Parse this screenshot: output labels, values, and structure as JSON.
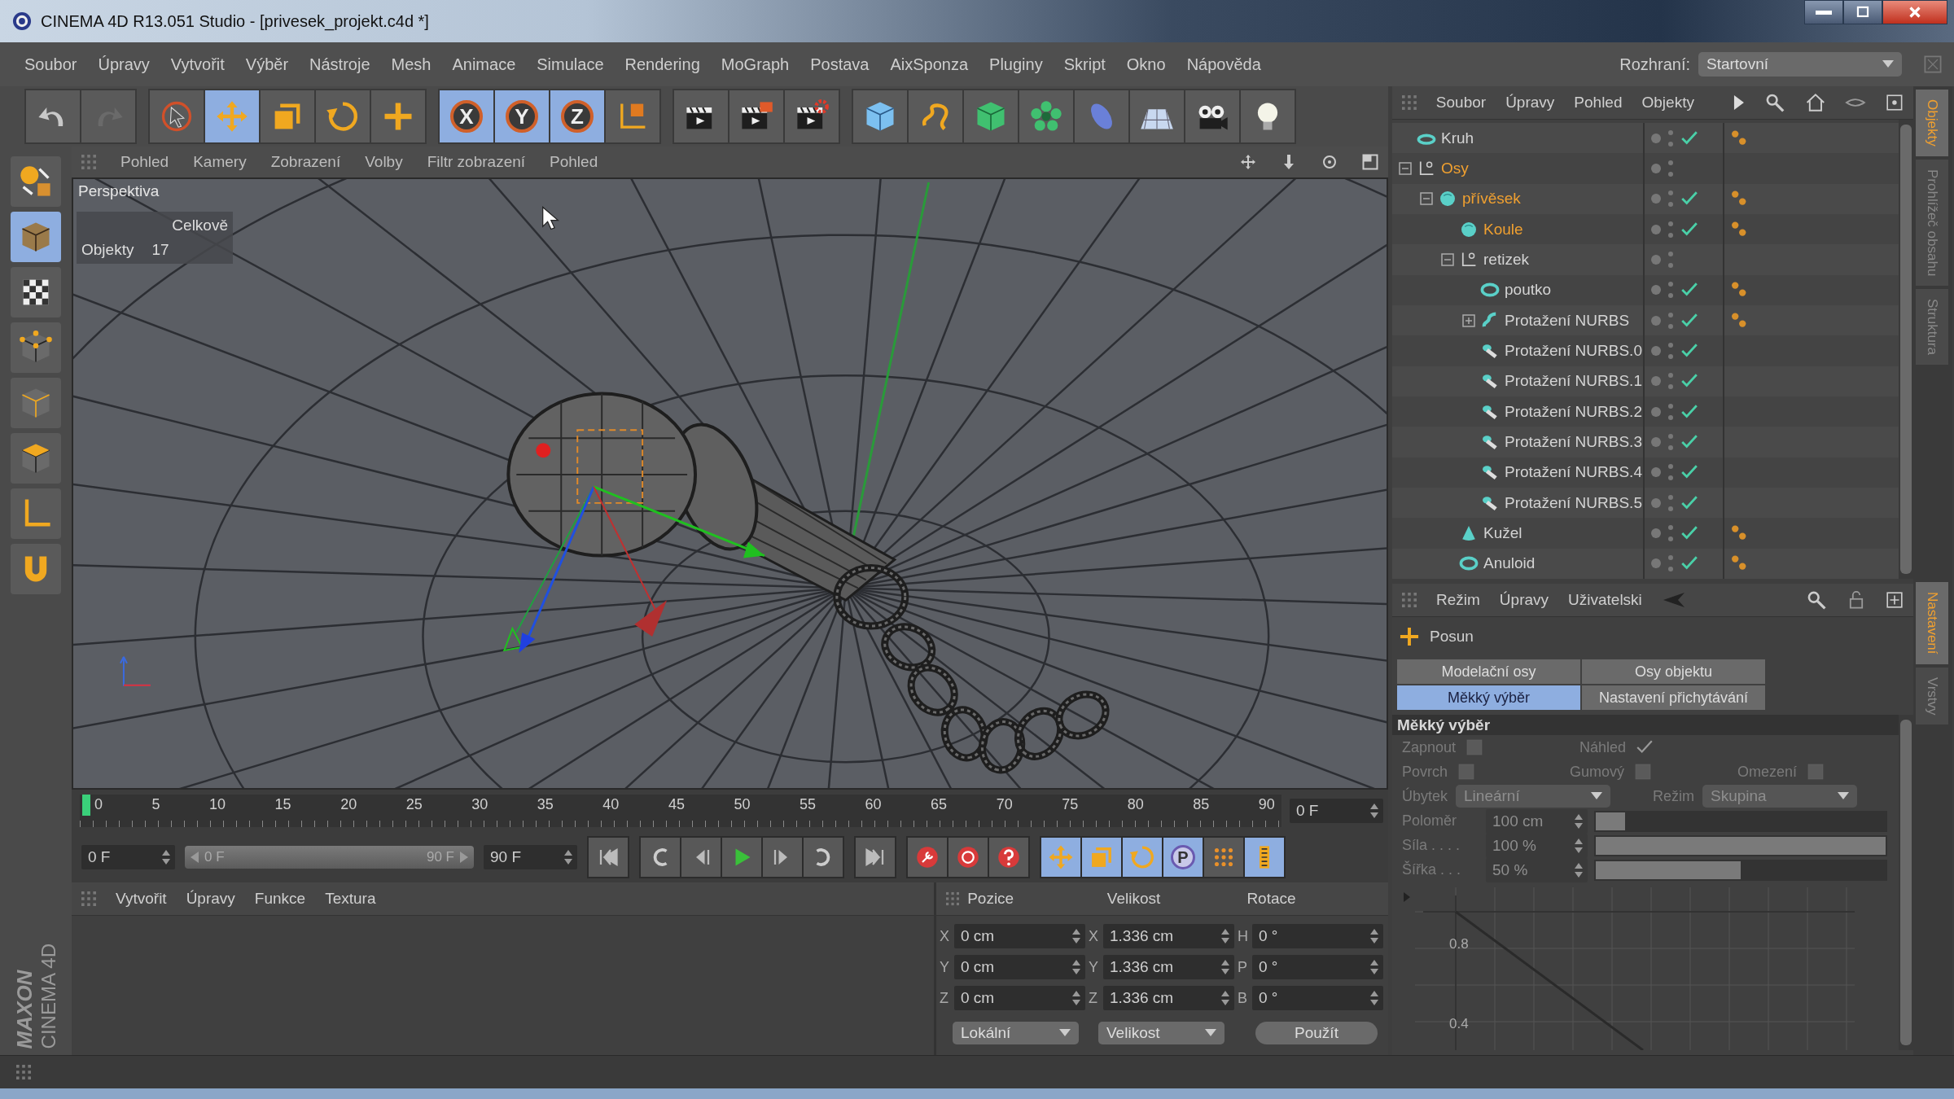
{
  "window": {
    "title": "CINEMA 4D R13.051 Studio - [privesek_projekt.c4d *]"
  },
  "menu_bar": {
    "items": [
      "Soubor",
      "Úpravy",
      "Vytvořit",
      "Výběr",
      "Nástroje",
      "Mesh",
      "Animace",
      "Simulace",
      "Rendering",
      "MoGraph",
      "Postava",
      "AixSponza",
      "Pluginy",
      "Skript",
      "Okno",
      "Nápověda"
    ],
    "layout_label": "Rozhraní:",
    "layout_value": "Startovní"
  },
  "toolbar": [
    {
      "items": [
        {
          "kind": "undo",
          "disabled": false
        },
        {
          "kind": "redo",
          "disabled": true
        }
      ]
    },
    {
      "items": [
        {
          "kind": "live-select",
          "selected": false
        },
        {
          "kind": "move",
          "selected": true
        },
        {
          "kind": "scale",
          "selected": false
        },
        {
          "kind": "rotate",
          "selected": false
        },
        {
          "kind": "add",
          "selected": false
        }
      ]
    },
    {
      "items": [
        {
          "kind": "axis",
          "label": "X",
          "selected": true
        },
        {
          "kind": "axis",
          "label": "Y",
          "selected": true
        },
        {
          "kind": "axis",
          "label": "Z",
          "selected": true
        },
        {
          "kind": "coordinate-system",
          "selected": false
        }
      ]
    },
    {
      "items": [
        {
          "kind": "render-view",
          "selected": false
        },
        {
          "kind": "render-picture",
          "selected": false
        },
        {
          "kind": "render-settings",
          "selected": false
        }
      ]
    },
    {
      "items": [
        {
          "kind": "cube",
          "selected": false
        },
        {
          "kind": "spline",
          "selected": false
        },
        {
          "kind": "nurbs",
          "selected": false
        },
        {
          "kind": "array",
          "selected": false
        },
        {
          "kind": "deformer",
          "selected": false
        },
        {
          "kind": "floor",
          "selected": false
        },
        {
          "kind": "camera",
          "selected": false
        },
        {
          "kind": "light",
          "selected": false
        }
      ]
    }
  ],
  "left_toolbar": [
    {
      "kind": "workplane",
      "selected": false
    },
    {
      "kind": "model",
      "selected": true
    },
    {
      "kind": "texture",
      "selected": false
    },
    {
      "kind": "points",
      "selected": false
    },
    {
      "kind": "edges",
      "selected": false
    },
    {
      "kind": "polygons",
      "selected": false
    },
    {
      "kind": "axis-mode",
      "selected": false
    },
    {
      "kind": "snap",
      "selected": false
    }
  ],
  "logo": {
    "line_1": "MAXON",
    "line_2": "CINEMA 4D"
  },
  "viewport": {
    "menu": [
      "Pohled",
      "Kamery",
      "Zobrazení",
      "Volby",
      "Filtr zobrazení",
      "Pohled"
    ],
    "camera": "Perspektiva",
    "stats_header": "Celkově",
    "stats": [
      {
        "label": "Objekty",
        "value": "17"
      }
    ]
  },
  "timeline": {
    "ticks": [
      "0",
      "5",
      "10",
      "15",
      "20",
      "25",
      "30",
      "35",
      "40",
      "45",
      "50",
      "55",
      "60",
      "65",
      "70",
      "75",
      "80",
      "85",
      "90"
    ],
    "level": 0,
    "frame": "0 F",
    "start": "0 F",
    "range": {
      "start": "0 F",
      "end": "90 F",
      "level": 1
    },
    "end": "90 F",
    "tools": [
      {
        "kind": "move",
        "selected": true
      },
      {
        "kind": "scale",
        "selected": true
      },
      {
        "kind": "rotate",
        "selected": true
      },
      {
        "kind": "parameter",
        "label": "P",
        "selected": true
      },
      {
        "kind": "point-level",
        "selected": false
      },
      {
        "kind": "timeline",
        "selected": true
      }
    ]
  },
  "material_manager": {
    "menu": [
      "Vytvořit",
      "Úpravy",
      "Funkce",
      "Textura"
    ]
  },
  "coordinates": {
    "headers": [
      "Pozice",
      "Velikost",
      "Rotace"
    ],
    "rows": [
      {
        "labels": [
          "X",
          "X",
          "H"
        ],
        "values": [
          "0 cm",
          "1.336 cm",
          "0 °"
        ]
      },
      {
        "labels": [
          "Y",
          "Y",
          "P"
        ],
        "values": [
          "0 cm",
          "1.336 cm",
          "0 °"
        ]
      },
      {
        "labels": [
          "Z",
          "Z",
          "B"
        ],
        "values": [
          "0 cm",
          "1.336 cm",
          "0 °"
        ]
      }
    ],
    "dropdowns": [
      "Lokální",
      "Velikost"
    ],
    "apply": "Použít"
  },
  "object_manager": {
    "menu": [
      "Soubor",
      "Úpravy",
      "Pohled",
      "Objekty"
    ],
    "tree": [
      {
        "name": "Kruh",
        "kind": "circle",
        "selected": false,
        "enabled": true,
        "tags": true
      },
      {
        "name": "Osy",
        "kind": "null",
        "selected": true,
        "enabled": false,
        "tags": false,
        "expanded": true,
        "children": [
          {
            "name": "přívěsek",
            "kind": "sphere",
            "selected": true,
            "enabled": true,
            "tags": true,
            "expanded": true,
            "children": [
              {
                "name": "Koule",
                "kind": "sphere",
                "selected": true,
                "enabled": true,
                "tags": true
              },
              {
                "name": "retizek",
                "kind": "null",
                "selected": false,
                "enabled": false,
                "tags": false,
                "expanded": true,
                "children": [
                  {
                    "name": "poutko",
                    "kind": "torus",
                    "selected": false,
                    "enabled": true,
                    "tags": true
                  },
                  {
                    "name": "Protažení NURBS",
                    "kind": "sweep",
                    "selected": false,
                    "enabled": true,
                    "tags": true,
                    "expanded": false
                  },
                  {
                    "name": "Protažení NURBS.0",
                    "kind": "sweep-copy",
                    "selected": false,
                    "enabled": true,
                    "tags": false
                  },
                  {
                    "name": "Protažení NURBS.1",
                    "kind": "sweep-copy",
                    "selected": false,
                    "enabled": true,
                    "tags": false
                  },
                  {
                    "name": "Protažení NURBS.2",
                    "kind": "sweep-copy",
                    "selected": false,
                    "enabled": true,
                    "tags": false
                  },
                  {
                    "name": "Protažení NURBS.3",
                    "kind": "sweep-copy",
                    "selected": false,
                    "enabled": true,
                    "tags": false
                  },
                  {
                    "name": "Protažení NURBS.4",
                    "kind": "sweep-copy",
                    "selected": false,
                    "enabled": true,
                    "tags": false
                  },
                  {
                    "name": "Protažení NURBS.5",
                    "kind": "sweep-copy",
                    "selected": false,
                    "enabled": true,
                    "tags": false
                  }
                ]
              },
              {
                "name": "Kužel",
                "kind": "cone",
                "selected": false,
                "enabled": true,
                "tags": true
              },
              {
                "name": "Anuloid",
                "kind": "torus",
                "selected": false,
                "enabled": true,
                "tags": true
              }
            ]
          }
        ]
      }
    ]
  },
  "side_tabs_top": [
    {
      "label": "Objekty",
      "selected": true
    },
    {
      "label": "Prohlížeč obsahu",
      "selected": false
    },
    {
      "label": "Struktura",
      "selected": false
    }
  ],
  "attributes": {
    "menu": [
      "Režim",
      "Úpravy",
      "Uživatelski"
    ],
    "tool": "Posun",
    "tabs": [
      {
        "label": "Modelační osy",
        "selected": false
      },
      {
        "label": "Osy objektu",
        "selected": false
      },
      {
        "label": "Měkký výběr",
        "selected": true
      },
      {
        "label": "Nastavení přichytávání",
        "selected": false
      }
    ],
    "section": "Měkký výběr",
    "param_rows": [
      [
        {
          "kind": "checkbox",
          "label": "Zapnout",
          "checked": false,
          "disabled": true
        },
        {
          "kind": "checkbox",
          "label": "Náhled",
          "checked": true,
          "disabled": true
        }
      ],
      [
        {
          "kind": "checkbox",
          "label": "Povrch",
          "checked": false,
          "disabled": true
        },
        {
          "kind": "checkbox",
          "label": "Gumový",
          "checked": false,
          "disabled": true
        },
        {
          "kind": "checkbox",
          "label": "Omezení",
          "checked": false,
          "disabled": true
        }
      ],
      [
        {
          "kind": "dropdown",
          "label": "Úbytek",
          "value": "Lineární",
          "disabled": true
        },
        {
          "kind": "dropdown",
          "label": "Režim",
          "value": "Skupina",
          "disabled": true
        }
      ],
      [
        {
          "kind": "slider",
          "label": "Poloměr",
          "value": "100 cm",
          "level": 0.1,
          "disabled": true
        }
      ],
      [
        {
          "kind": "slider",
          "label": "Síla . . . .",
          "value": "100 %",
          "level": 1,
          "disabled": true
        }
      ],
      [
        {
          "kind": "slider",
          "label": "Šířka . . .",
          "value": "50 %",
          "level": 0.5,
          "disabled": true
        }
      ]
    ],
    "falloff": {
      "tick_labels": [
        "0.8",
        "0.4"
      ]
    }
  },
  "side_tabs_bottom": [
    {
      "label": "Nastavení",
      "selected": true
    },
    {
      "label": "Vrstvy",
      "selected": false
    }
  ]
}
